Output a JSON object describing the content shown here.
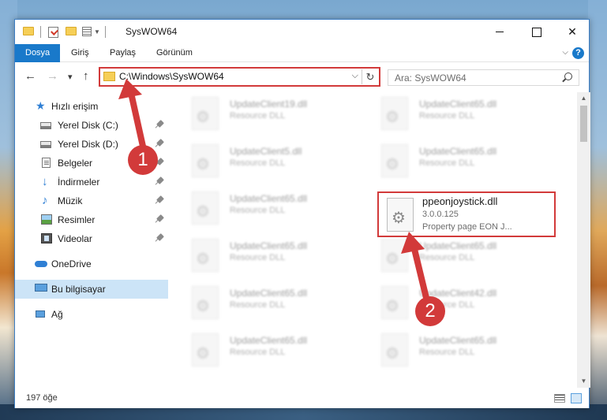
{
  "window": {
    "title": "SysWOW64",
    "controls": {
      "close": "✕"
    }
  },
  "ribbon": {
    "tabs": [
      "Dosya",
      "Giriş",
      "Paylaş",
      "Görünüm"
    ],
    "help": "?"
  },
  "navigation": {
    "back": "←",
    "forward": "→",
    "recent": "▾",
    "up": "↑",
    "address": "C:\\Windows\\SysWOW64",
    "refresh": "↻",
    "search_placeholder": "Ara: SysWOW64"
  },
  "sidebar": {
    "items": [
      {
        "label": "Hızlı erişim",
        "icon": "quick-access-star-icon",
        "pinned": false
      },
      {
        "label": "Yerel Disk (C:)",
        "icon": "drive-icon",
        "pinned": true
      },
      {
        "label": "Yerel Disk (D:)",
        "icon": "drive-icon",
        "pinned": true
      },
      {
        "label": "Belgeler",
        "icon": "documents-icon",
        "pinned": true
      },
      {
        "label": "İndirmeler",
        "icon": "downloads-icon",
        "pinned": true
      },
      {
        "label": "Müzik",
        "icon": "music-icon",
        "pinned": true
      },
      {
        "label": "Resimler",
        "icon": "pictures-icon",
        "pinned": true
      },
      {
        "label": "Videolar",
        "icon": "videos-icon",
        "pinned": true
      },
      {
        "label": "OneDrive",
        "icon": "onedrive-cloud-icon",
        "pinned": false
      },
      {
        "label": "Bu bilgisayar",
        "icon": "this-pc-icon",
        "pinned": false,
        "selected": true
      },
      {
        "label": "Ağ",
        "icon": "network-icon",
        "pinned": false
      }
    ]
  },
  "files": [
    {
      "name": "UpdateClient19.dll",
      "type": "Resource DLL"
    },
    {
      "name": "UpdateClient65.dll",
      "type": "Resource DLL"
    },
    {
      "name": "UpdateClient5.dll",
      "type": "Resource DLL"
    },
    {
      "name": "UpdateClient65.dll",
      "type": "Resource DLL"
    },
    {
      "name": "UpdateClient65.dll",
      "type": "Resource DLL"
    },
    {
      "name": "UpdateClient65.dll",
      "type": "Resource DLL"
    },
    {
      "name": "UpdateClient65.dll",
      "type": "Resource DLL"
    },
    {
      "name": "UpdateClient65.dll",
      "type": "Resource DLL"
    },
    {
      "name": "UpdateClient42.dll",
      "type": "Resource DLL"
    },
    {
      "name": "UpdateClient65.dll",
      "type": "Resource DLL"
    },
    {
      "name": "UpdateClient65.dll",
      "type": "Resource DLL"
    }
  ],
  "highlighted_file": {
    "name": "ppeonjoystick.dll",
    "version": "3.0.0.125",
    "description": "Property page EON J..."
  },
  "status": {
    "item_count": "197 öğe"
  },
  "annotations": {
    "marker1": "1",
    "marker2": "2",
    "color": "#d23a3a"
  }
}
